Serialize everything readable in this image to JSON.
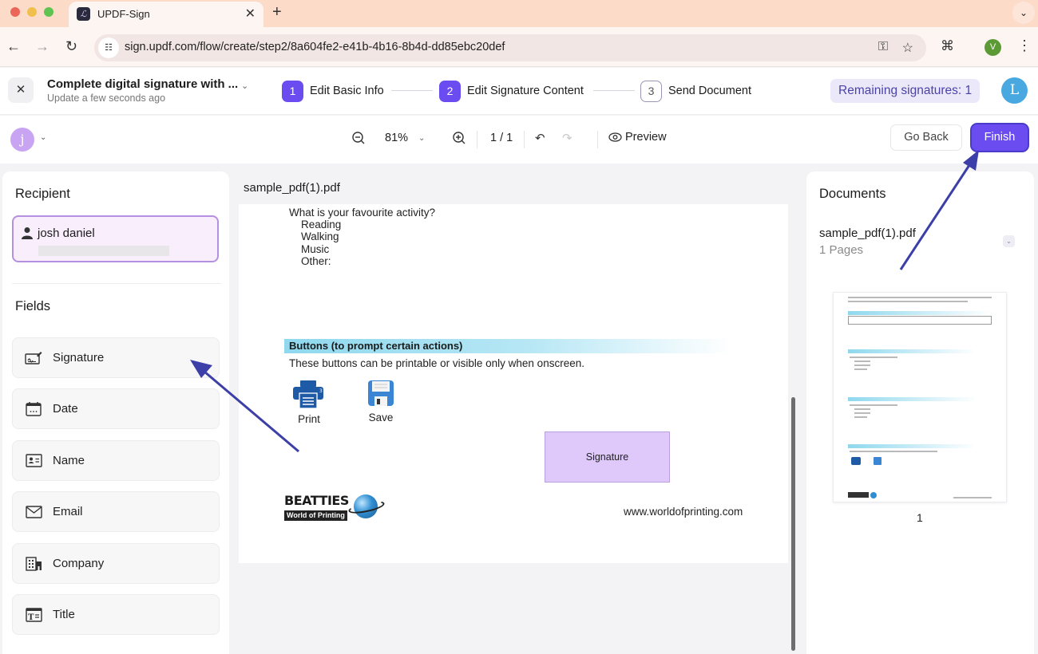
{
  "browser": {
    "tab_title": "UPDF-Sign",
    "url": "sign.updf.com/flow/create/step2/8a604fe2-e41b-4b16-8b4d-dd85ebc20def",
    "profile_initial": "V"
  },
  "header": {
    "document_title": "Complete digital signature with ...",
    "updated_text": "Update a few seconds ago",
    "steps": [
      {
        "number": "1",
        "label": "Edit Basic Info",
        "state": "done"
      },
      {
        "number": "2",
        "label": "Edit Signature Content",
        "state": "current"
      },
      {
        "number": "3",
        "label": "Send Document",
        "state": "pending"
      }
    ],
    "remaining_signatures": "Remaining signatures: 1",
    "account_initial": "L"
  },
  "editor_toolbar": {
    "recipient_initial": "j",
    "zoom_level": "81%",
    "page_indicator": "1 / 1",
    "preview_label": "Preview",
    "go_back_label": "Go Back",
    "finish_label": "Finish"
  },
  "left_panel": {
    "recipient_heading": "Recipient",
    "recipient_name": "josh daniel",
    "fields_heading": "Fields",
    "fields": [
      {
        "label": "Signature",
        "icon": "signature-icon"
      },
      {
        "label": "Date",
        "icon": "calendar-icon"
      },
      {
        "label": "Name",
        "icon": "id-card-icon"
      },
      {
        "label": "Email",
        "icon": "envelope-icon"
      },
      {
        "label": "Company",
        "icon": "building-icon"
      },
      {
        "label": "Title",
        "icon": "title-text-icon"
      }
    ]
  },
  "document": {
    "file_name": "sample_pdf(1).pdf",
    "question": "What is your favourite activity?",
    "options": [
      "Reading",
      "Walking",
      "Music",
      "Other:"
    ],
    "section_title": "Buttons (to prompt certain actions)",
    "section_desc": "These buttons can be printable or visible only when onscreen.",
    "print_label": "Print",
    "save_label": "Save",
    "signature_field_label": "Signature",
    "logo_top": "BEATTIES",
    "logo_bottom": "World of Printing",
    "website": "www.worldofprinting.com"
  },
  "right_panel": {
    "heading": "Documents",
    "file_name": "sample_pdf(1).pdf",
    "page_count": "1 Pages",
    "thumbnail_page_number": "1"
  },
  "colors": {
    "accent": "#6a4cf0",
    "signature_field": "#dfc9fb",
    "recipient_border": "#b690e0",
    "annotation_arrow": "#3d3fa8"
  }
}
